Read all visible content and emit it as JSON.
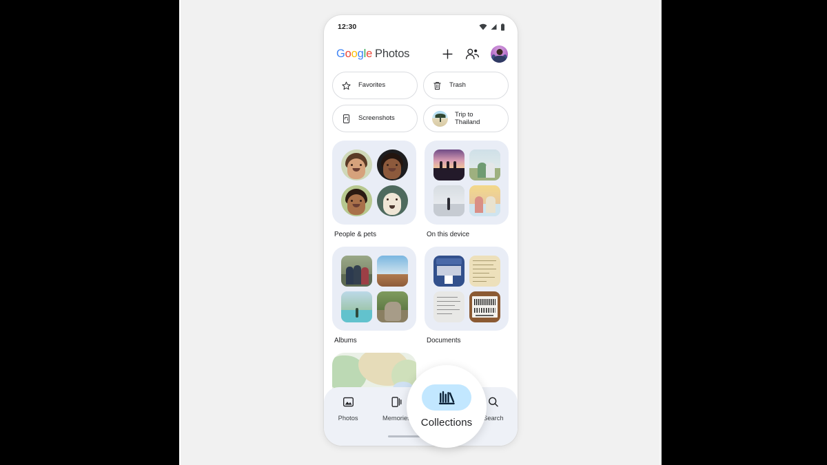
{
  "status_bar": {
    "time": "12:30",
    "icons": [
      "wifi-icon",
      "cellular-signal-icon",
      "battery-icon"
    ]
  },
  "app_bar": {
    "logo_google": "Google",
    "logo_google_letters": [
      "G",
      "o",
      "o",
      "g",
      "l",
      "e"
    ],
    "logo_product": "Photos",
    "add_label": "+",
    "actions": [
      "add-icon",
      "sharing-people-icon",
      "account-avatar"
    ]
  },
  "chips": [
    {
      "label": "Favorites",
      "icon": "star-icon",
      "name": "chip-favorites"
    },
    {
      "label": "Trash",
      "icon": "trash-icon",
      "name": "chip-trash"
    },
    {
      "label": "Screenshots",
      "icon": "screenshot-icon",
      "name": "chip-screenshots"
    },
    {
      "label": "Trip to\nThailand",
      "label_line1": "Trip to",
      "label_line2": "Thailand",
      "icon": "photo-thumbnail",
      "name": "chip-trip-to-thailand"
    }
  ],
  "cards": [
    {
      "label": "People & pets",
      "name": "card-people-and-pets",
      "shape": "circle"
    },
    {
      "label": "On this device",
      "name": "card-on-this-device",
      "shape": "square"
    },
    {
      "label": "Albums",
      "name": "card-albums",
      "shape": "square"
    },
    {
      "label": "Documents",
      "name": "card-documents",
      "shape": "square"
    }
  ],
  "bottom_nav": {
    "items": [
      {
        "label": "Photos",
        "icon": "photos-icon",
        "active": false
      },
      {
        "label": "Memories",
        "icon": "memories-icon",
        "active": false
      },
      {
        "label": "Collections",
        "icon": "collections-icon",
        "active": true
      },
      {
        "label": "Search",
        "icon": "search-icon",
        "active": false
      }
    ]
  },
  "magnifier": {
    "label": "Collections",
    "icon": "collections-icon"
  },
  "colors": {
    "google_blue": "#4285F4",
    "google_red": "#EA4335",
    "google_yellow": "#FBBC05",
    "google_green": "#34A853",
    "active_pill": "#c2e7ff",
    "card_background": "#e9edf6",
    "nav_background": "#eef1f7",
    "page_background": "#f1f1f1"
  }
}
